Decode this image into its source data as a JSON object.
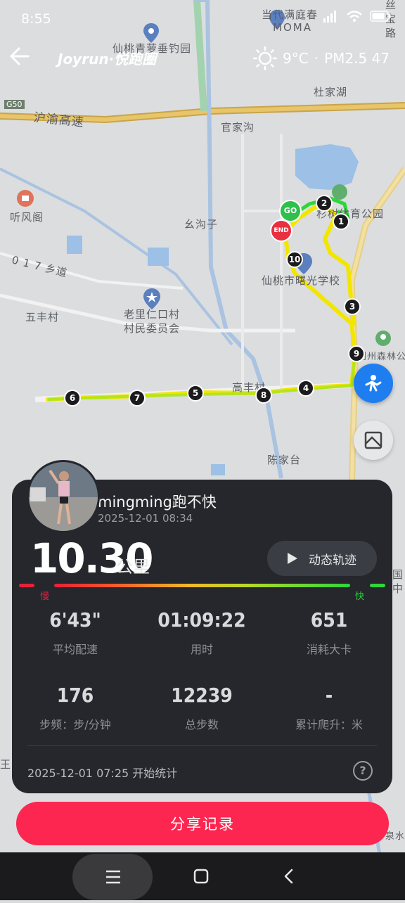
{
  "status_bar": {
    "time": "8:55",
    "icons": [
      "signal-icon",
      "wifi-icon",
      "battery-icon"
    ]
  },
  "app_bar": {
    "brand": "Joyrun·悦跑圈",
    "weather_icon": "sun-icon",
    "temperature": "9°C",
    "separator": "·",
    "air_quality": "PM2.5 47"
  },
  "map": {
    "labels": {
      "l1": "当代满庭春",
      "l2": "MOMA",
      "l3": "仙桃青萝垂钓园",
      "l4": "丝",
      "l5": "宝",
      "l6": "路",
      "l7": "杜家湖",
      "l8": "沪渝高速",
      "l9": "G50",
      "l10": "官家沟",
      "l11": "听风阁",
      "l12": "幺沟子",
      "l13": "杉树体育公园",
      "l14": "0 1 7 乡道",
      "l15": "仙桃市曙光学校",
      "l16": "五丰村",
      "l17": "老里仁口村",
      "l18": "村民委员会",
      "l19": "荆州森林公",
      "l20": "高丰村",
      "l21": "陈家台",
      "l22": "王",
      "l23": "国",
      "l24": "中",
      "l25": "泉水"
    },
    "markers": {
      "go": "GO",
      "end": "END",
      "km": [
        "1",
        "2",
        "3",
        "4",
        "5",
        "6",
        "7",
        "8",
        "9",
        "10"
      ]
    }
  },
  "card": {
    "username": "mingming跑不快",
    "datetime": "2025-12-01 08:34",
    "distance": "10.30",
    "distance_unit": "公里",
    "track_button": "动态轨迹",
    "speed_slow": "慢",
    "speed_fast": "快",
    "stats": [
      {
        "value": "6'43\"",
        "label": "平均配速"
      },
      {
        "value": "01:09:22",
        "label": "用时"
      },
      {
        "value": "651",
        "label": "消耗大卡"
      },
      {
        "value": "176",
        "label": "步频：步/分钟"
      },
      {
        "value": "12239",
        "label": "总步数"
      },
      {
        "value": "-",
        "label": "累计爬升：米"
      }
    ],
    "start_info": "2025-12-01 07:25  开始统计",
    "help_label": "?"
  },
  "share_button": "分享记录",
  "colors": {
    "accent": "#fd2650",
    "card_bg": "#25272c",
    "route_green": "#9be22a",
    "route_yellow": "#f2e600"
  }
}
